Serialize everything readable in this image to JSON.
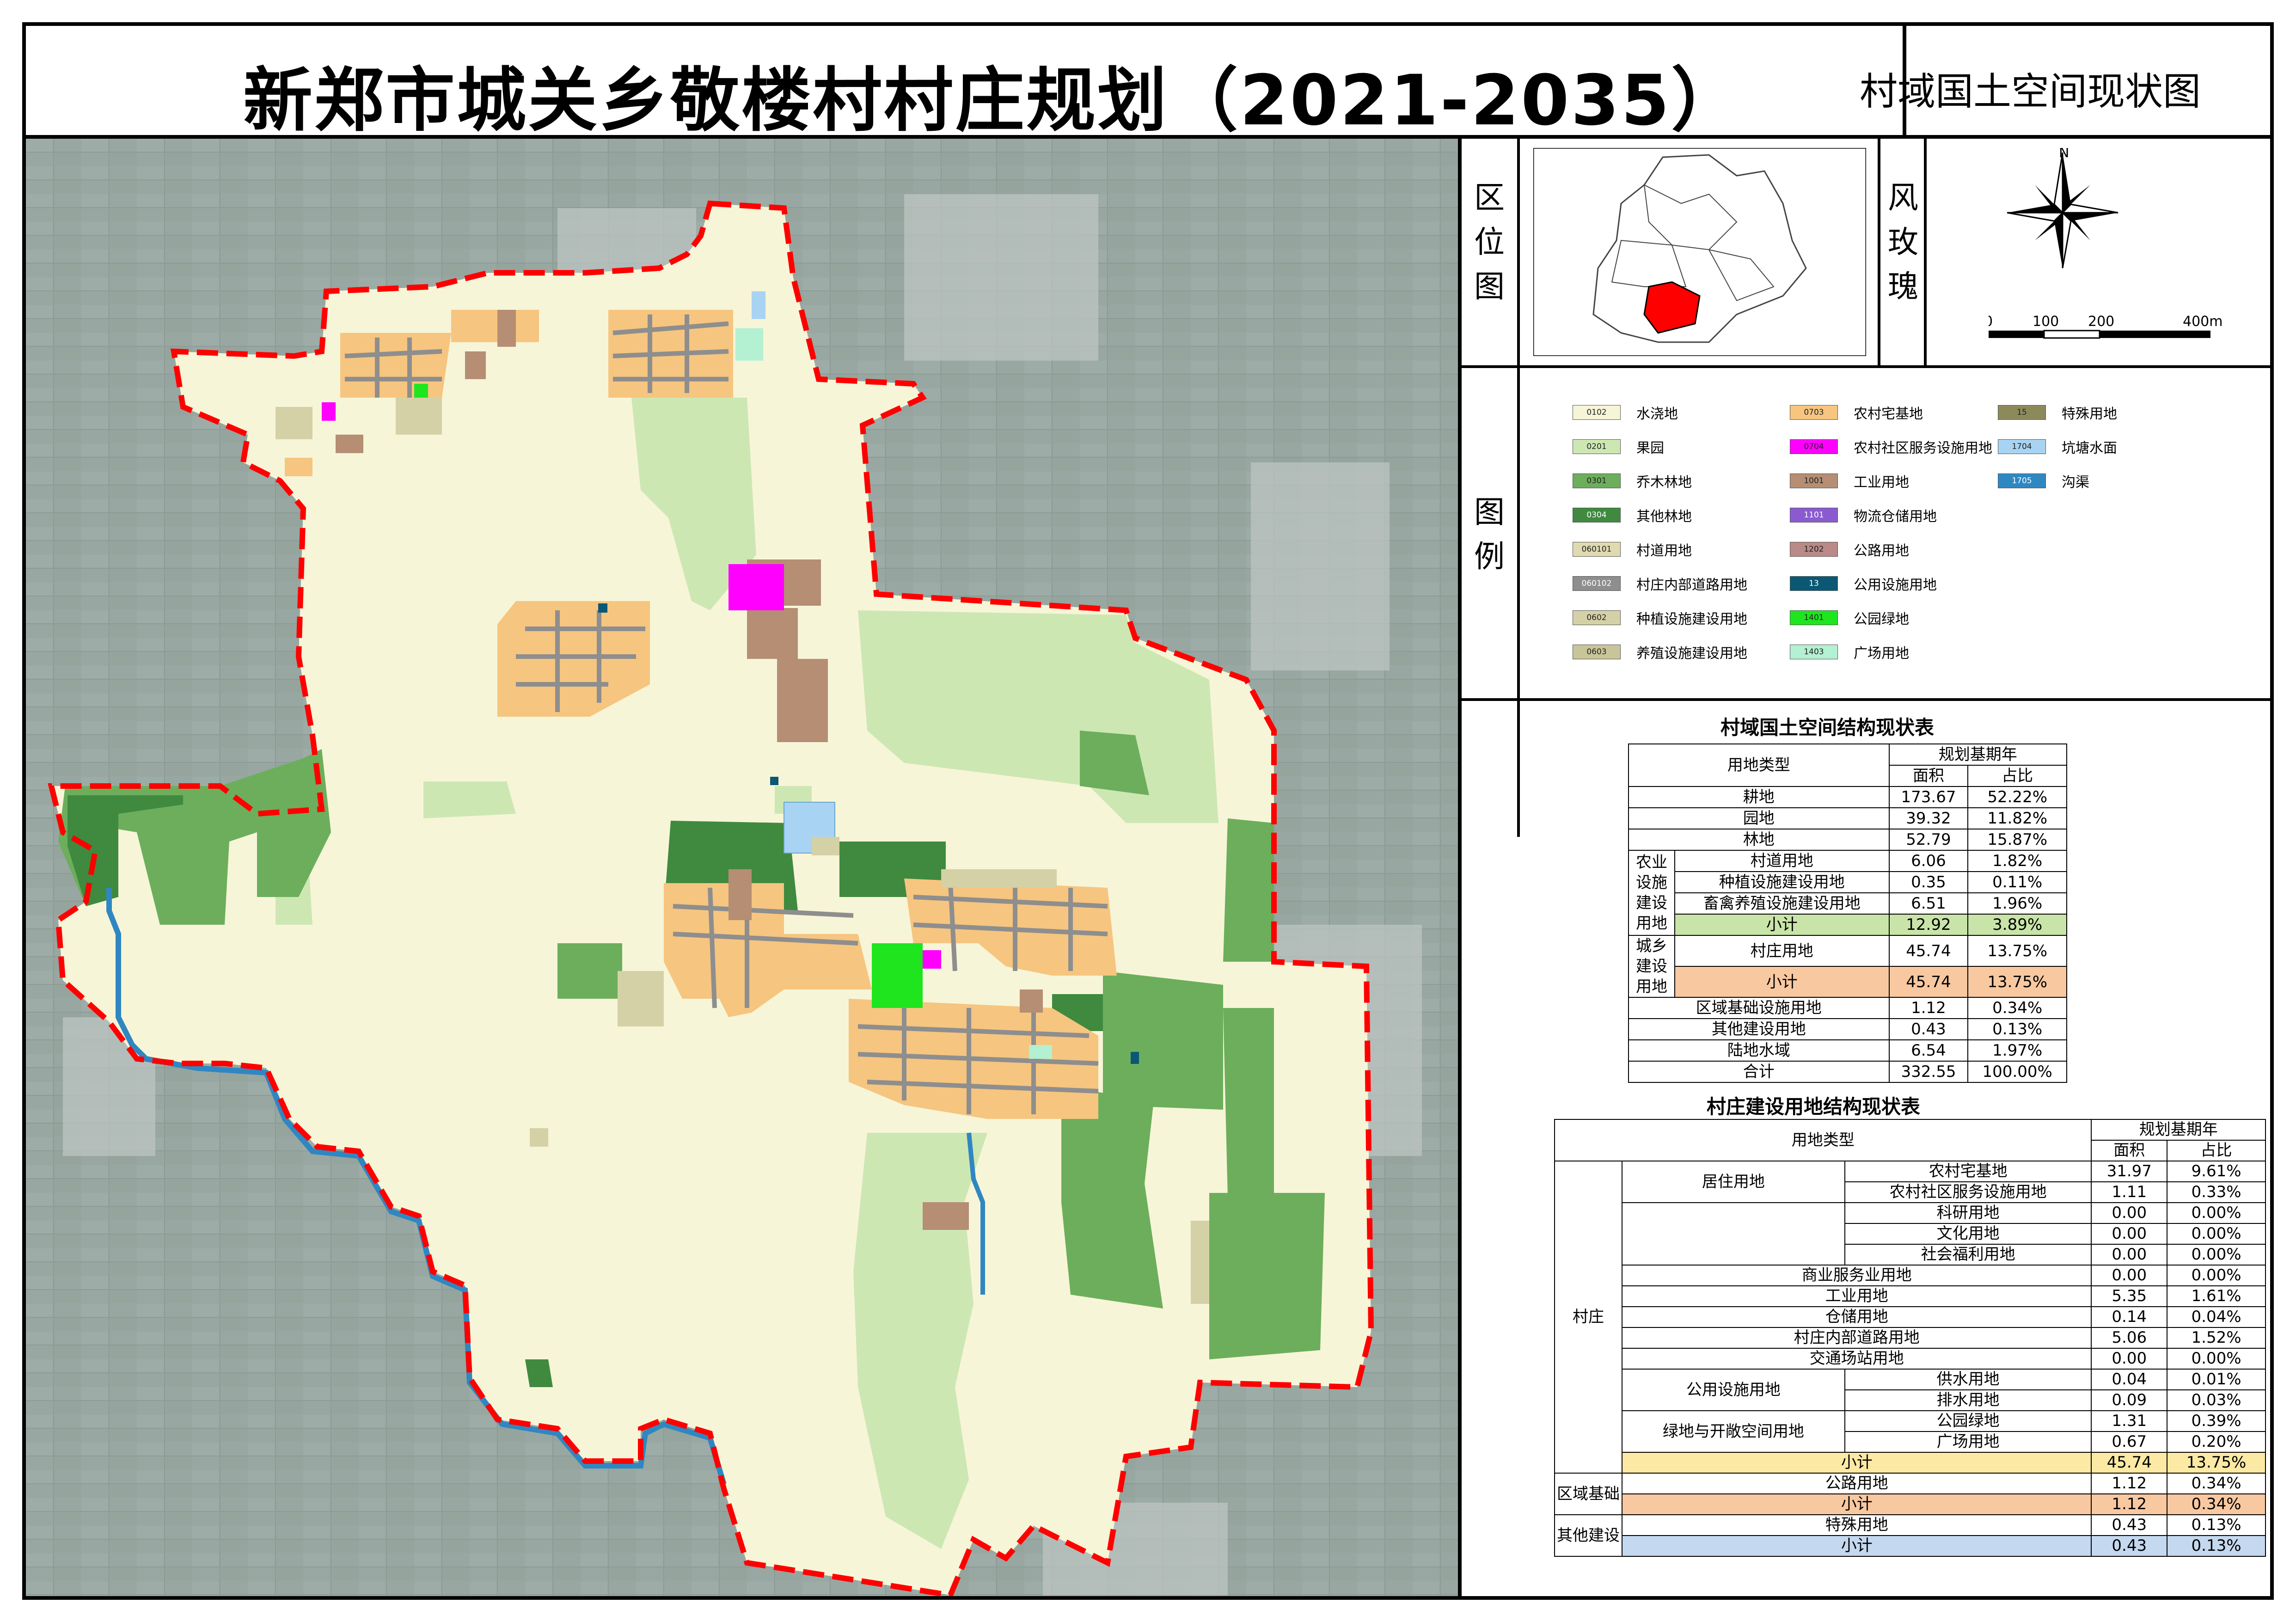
{
  "header": {
    "title": "新郑市城关乡敬楼村村庄规划（2021-2035）",
    "subtitle": "村域国土空间现状图"
  },
  "locator": {
    "label": "区位图"
  },
  "compass": {
    "label": "风玫瑰",
    "north": "N",
    "scale_ticks": [
      "0",
      "100",
      "200",
      "400m"
    ]
  },
  "legend": {
    "label": "图例",
    "items": [
      {
        "code": "0102",
        "label": "水浇地",
        "color": "#f7f5d7"
      },
      {
        "code": "0201",
        "label": "果园",
        "color": "#cde7b3"
      },
      {
        "code": "0301",
        "label": "乔木林地",
        "color": "#6cae5c"
      },
      {
        "code": "0304",
        "label": "其他林地",
        "color": "#3f8a3f"
      },
      {
        "code": "060101",
        "label": "村道用地",
        "color": "#dfdab0"
      },
      {
        "code": "060102",
        "label": "村庄内部道路用地",
        "color": "#8e8e8e"
      },
      {
        "code": "0602",
        "label": "种植设施建设用地",
        "color": "#d4d1a6"
      },
      {
        "code": "0603",
        "label": "养殖设施建设用地",
        "color": "#c9c59a"
      },
      {
        "code": "0703",
        "label": "农村宅基地",
        "color": "#f6c57f"
      },
      {
        "code": "0704",
        "label": "农村社区服务设施用地",
        "color": "#ff00ff"
      },
      {
        "code": "1001",
        "label": "工业用地",
        "color": "#b58e73"
      },
      {
        "code": "1101",
        "label": "物流仓储用地",
        "color": "#8a5bd0"
      },
      {
        "code": "1202",
        "label": "公路用地",
        "color": "#b98a87"
      },
      {
        "code": "13",
        "label": "公用设施用地",
        "color": "#0b5874"
      },
      {
        "code": "1401",
        "label": "公园绿地",
        "color": "#1ee51e"
      },
      {
        "code": "1403",
        "label": "广场用地",
        "color": "#b4f0d2"
      },
      {
        "code": "15",
        "label": "特殊用地",
        "color": "#8c8a5a"
      },
      {
        "code": "1704",
        "label": "坑塘水面",
        "color": "#a9d3f2"
      },
      {
        "code": "1705",
        "label": "沟渠",
        "color": "#2f87c2"
      }
    ]
  },
  "table1": {
    "title": "村域国土空间结构现状表",
    "header_type": "用地类型",
    "header_period": "规划基期年",
    "header_area": "面积",
    "header_ratio": "占比",
    "rows": [
      {
        "group": "",
        "name": "耕地",
        "area": "173.67",
        "ratio": "52.22%"
      },
      {
        "group": "",
        "name": "园地",
        "area": "39.32",
        "ratio": "11.82%"
      },
      {
        "group": "",
        "name": "林地",
        "area": "52.79",
        "ratio": "15.87%"
      },
      {
        "group": "农业设施建设用地",
        "name": "村道用地",
        "area": "6.06",
        "ratio": "1.82%"
      },
      {
        "group": "农业设施建设用地",
        "name": "种植设施建设用地",
        "area": "0.35",
        "ratio": "0.11%"
      },
      {
        "group": "农业设施建设用地",
        "name": "畜禽养殖设施建设用地",
        "area": "6.51",
        "ratio": "1.96%"
      },
      {
        "group": "农业设施建设用地",
        "name": "小计",
        "area": "12.92",
        "ratio": "3.89%"
      },
      {
        "group": "城乡建设用地",
        "name": "村庄用地",
        "area": "45.74",
        "ratio": "13.75%"
      },
      {
        "group": "城乡建设用地",
        "name": "小计",
        "area": "45.74",
        "ratio": "13.75%"
      },
      {
        "group": "",
        "name": "区域基础设施用地",
        "area": "1.12",
        "ratio": "0.34%"
      },
      {
        "group": "",
        "name": "其他建设用地",
        "area": "0.43",
        "ratio": "0.13%"
      },
      {
        "group": "",
        "name": "陆地水域",
        "area": "6.54",
        "ratio": "1.97%"
      },
      {
        "group": "",
        "name": "合计",
        "area": "332.55",
        "ratio": "100.00%"
      }
    ],
    "group_agri_label": "农业设施建设用地",
    "group_urban_label": "城乡建设用地"
  },
  "table2": {
    "title": "村庄建设用地结构现状表",
    "header_type": "用地类型",
    "header_period": "规划基期年",
    "header_area": "面积",
    "header_ratio": "占比",
    "village_label": "村庄",
    "residential_label": "居住用地",
    "public_utility_label": "公用设施用地",
    "green_label": "绿地与开敞空间用地",
    "regional_label": "区域基础",
    "other_label": "其他建设",
    "rows": [
      {
        "name": "农村宅基地",
        "area": "31.97",
        "ratio": "9.61%"
      },
      {
        "name": "农村社区服务设施用地",
        "area": "1.11",
        "ratio": "0.33%"
      },
      {
        "name": "科研用地",
        "area": "0.00",
        "ratio": "0.00%"
      },
      {
        "name": "文化用地",
        "area": "0.00",
        "ratio": "0.00%"
      },
      {
        "name": "社会福利用地",
        "area": "0.00",
        "ratio": "0.00%"
      },
      {
        "name": "商业服务业用地",
        "area": "0.00",
        "ratio": "0.00%"
      },
      {
        "name": "工业用地",
        "area": "5.35",
        "ratio": "1.61%"
      },
      {
        "name": "仓储用地",
        "area": "0.14",
        "ratio": "0.04%"
      },
      {
        "name": "村庄内部道路用地",
        "area": "5.06",
        "ratio": "1.52%"
      },
      {
        "name": "交通场站用地",
        "area": "0.00",
        "ratio": "0.00%"
      },
      {
        "name": "供水用地",
        "area": "0.04",
        "ratio": "0.01%"
      },
      {
        "name": "排水用地",
        "area": "0.09",
        "ratio": "0.03%"
      },
      {
        "name": "公园绿地",
        "area": "1.31",
        "ratio": "0.39%"
      },
      {
        "name": "广场用地",
        "area": "0.67",
        "ratio": "0.20%"
      },
      {
        "name": "小计",
        "area": "45.74",
        "ratio": "13.75%"
      },
      {
        "name": "公路用地",
        "area": "1.12",
        "ratio": "0.34%"
      },
      {
        "name": "小计",
        "area": "1.12",
        "ratio": "0.34%"
      },
      {
        "name": "特殊用地",
        "area": "0.43",
        "ratio": "0.13%"
      },
      {
        "name": "小计",
        "area": "0.43",
        "ratio": "0.13%"
      }
    ]
  }
}
